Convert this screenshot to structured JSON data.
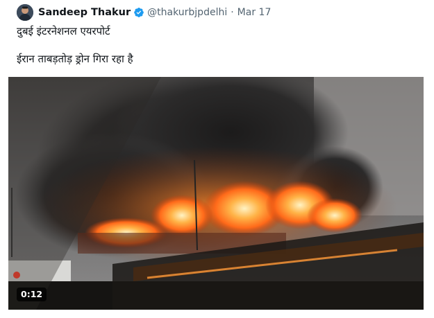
{
  "tweet": {
    "author": {
      "display_name": "Sandeep Thakur",
      "handle": "@thakurbjpdelhi",
      "verified_icon": "verified-badge-icon",
      "avatar_icon": "avatar"
    },
    "separator": "·",
    "date": "Mar 17",
    "text_lines": [
      "दुबई इंटरनेशनल एयरपोर्ट",
      "ईरान ताबड़तोड़ ड्रोन गिरा रहा है"
    ],
    "media": {
      "type": "video",
      "duration": "0:12"
    }
  },
  "colors": {
    "text_primary": "#0f1419",
    "text_secondary": "#536471",
    "verified_blue": "#1d9bf0"
  }
}
